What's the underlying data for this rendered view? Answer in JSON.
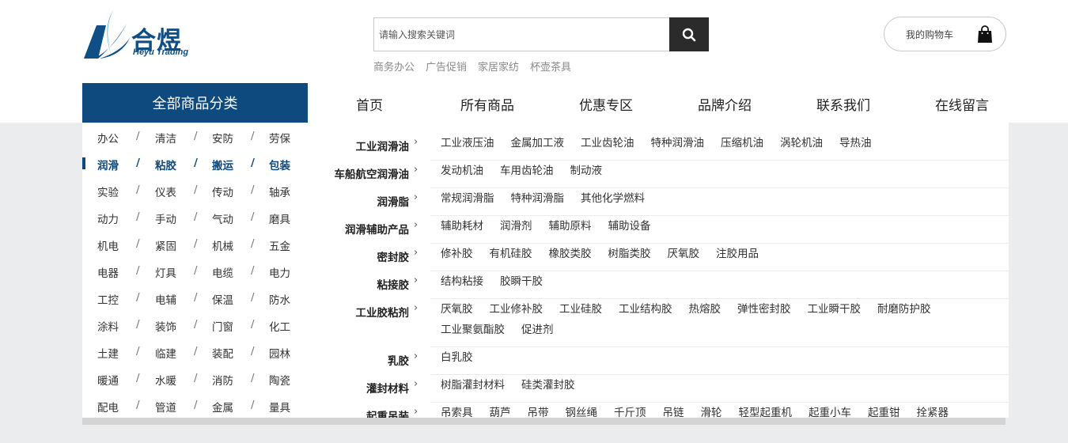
{
  "logo": {
    "cn": "合煜",
    "en": "Heyu Trading"
  },
  "search": {
    "placeholder": "请输入搜索关键词",
    "hot_words": [
      "商务办公",
      "广告促销",
      "家居家纺",
      "杯壶茶具"
    ]
  },
  "cart": {
    "label": "我的购物车"
  },
  "nav": {
    "all_categories": "全部商品分类",
    "items": [
      "首页",
      "所有商品",
      "优惠专区",
      "品牌介绍",
      "联系我们",
      "在线留言"
    ]
  },
  "categories": [
    [
      "办公",
      "清洁",
      "安防",
      "劳保"
    ],
    [
      "润滑",
      "粘胶",
      "搬运",
      "包装"
    ],
    [
      "实验",
      "仪表",
      "传动",
      "轴承"
    ],
    [
      "动力",
      "手动",
      "气动",
      "磨具"
    ],
    [
      "机电",
      "紧固",
      "机械",
      "五金"
    ],
    [
      "电器",
      "灯具",
      "电缆",
      "电力"
    ],
    [
      "工控",
      "电辅",
      "保温",
      "防水"
    ],
    [
      "涂料",
      "装饰",
      "门窗",
      "化工"
    ],
    [
      "土建",
      "临建",
      "装配",
      "园林"
    ],
    [
      "暖通",
      "水暖",
      "消防",
      "陶瓷"
    ],
    [
      "配电",
      "管道",
      "金属",
      "量具"
    ]
  ],
  "active_category_row": 1,
  "separator": "/",
  "subcategories": [
    {
      "title": "工业润滑油",
      "items": [
        "工业液压油",
        "金属加工液",
        "工业齿轮油",
        "特种润滑油",
        "压缩机油",
        "涡轮机油",
        "导热油"
      ]
    },
    {
      "title": "车船航空润滑油",
      "items": [
        "发动机油",
        "车用齿轮油",
        "制动液"
      ]
    },
    {
      "title": "润滑脂",
      "items": [
        "常规润滑脂",
        "特种润滑脂",
        "其他化学燃料"
      ]
    },
    {
      "title": "润滑辅助产品",
      "items": [
        "辅助耗材",
        "润滑剂",
        "辅助原料",
        "辅助设备"
      ]
    },
    {
      "title": "密封胶",
      "items": [
        "修补胶",
        "有机硅胶",
        "橡胶类胶",
        "树脂类胶",
        "厌氧胶",
        "注胶用品"
      ]
    },
    {
      "title": "粘接胶",
      "items": [
        "结构粘接",
        "胶瞬干胶"
      ]
    },
    {
      "title": "工业胶粘剂",
      "items": [
        "厌氧胶",
        "工业修补胶",
        "工业硅胶",
        "工业结构胶",
        "热熔胶",
        "弹性密封胶",
        "工业瞬干胶",
        "耐磨防护胶",
        "工业聚氨酯胶",
        "促进剂"
      ]
    },
    {
      "title": "乳胶",
      "items": [
        "白乳胶"
      ]
    },
    {
      "title": "灌封材料",
      "items": [
        "树脂灌封材料",
        "硅类灌封胶"
      ]
    },
    {
      "title": "起重吊装",
      "items": [
        "吊索具",
        "葫芦",
        "吊带",
        "钢丝绳",
        "千斤顶",
        "吊链",
        "滑轮",
        "轻型起重机",
        "起重小车",
        "起重钳",
        "拴紧器"
      ]
    }
  ],
  "arrow_glyph": "›",
  "colors": {
    "brand": "#0f4a7e",
    "search_button": "#2b2b2b",
    "background": "#ebeced"
  }
}
